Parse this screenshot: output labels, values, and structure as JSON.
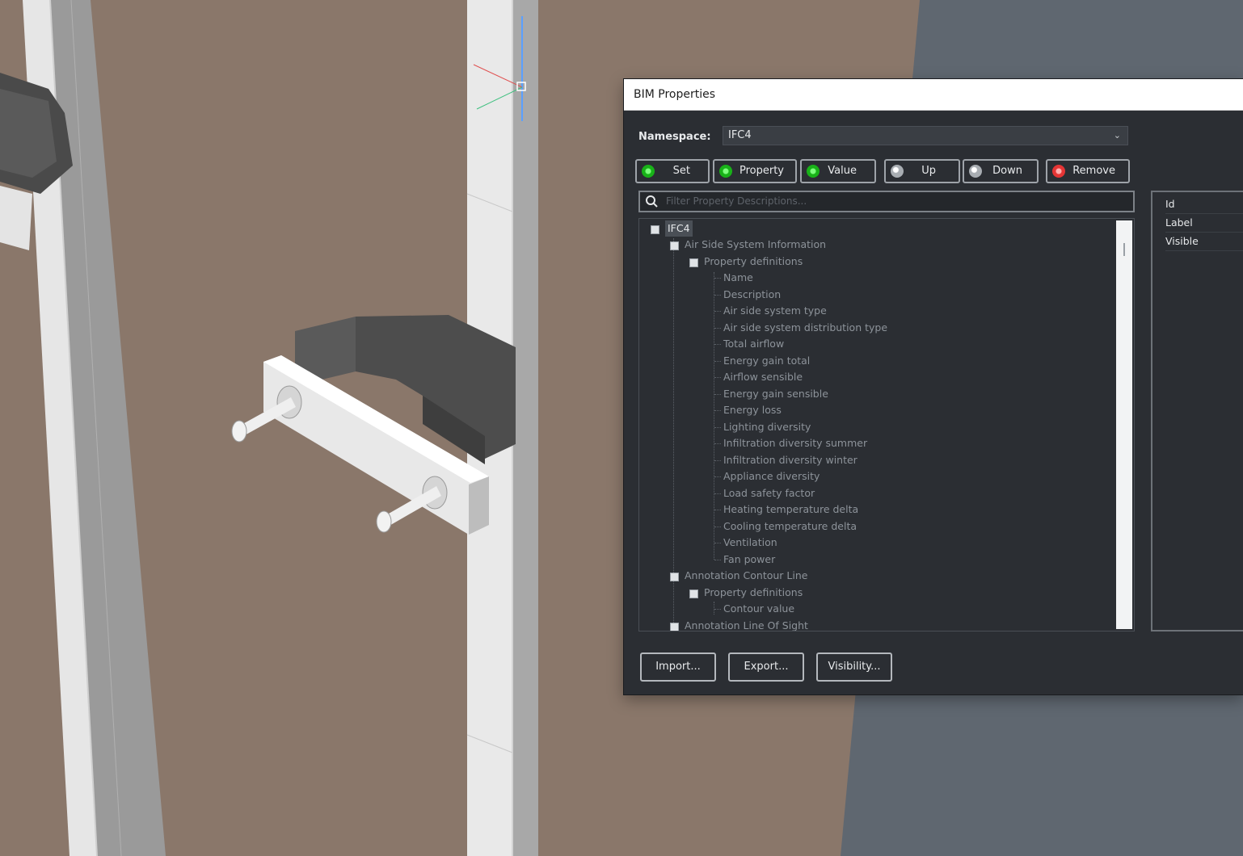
{
  "dialog": {
    "title": "BIM Properties",
    "namespace_label": "Namespace:",
    "namespace_value": "IFC4",
    "toolbar": [
      {
        "label": "Set",
        "icon": "add-icon"
      },
      {
        "label": "Property",
        "icon": "add-icon"
      },
      {
        "label": "Value",
        "icon": "add-icon"
      },
      {
        "label": "Up",
        "icon": "up-icon"
      },
      {
        "label": "Down",
        "icon": "down-icon"
      },
      {
        "label": "Remove",
        "icon": "remove-icon"
      }
    ],
    "search_placeholder": "Filter Property Descriptions...",
    "tree": {
      "root": "IFC4",
      "set1": "Air Side System Information",
      "set1_group": "Property definitions",
      "set1_props": [
        "Name",
        "Description",
        "Air side system type",
        "Air side system distribution type",
        "Total airflow",
        "Energy gain total",
        "Airflow sensible",
        "Energy gain sensible",
        "Energy loss",
        "Lighting diversity",
        "Infiltration diversity summer",
        "Infiltration diversity winter",
        "Appliance diversity",
        "Load safety factor",
        "Heating temperature delta",
        "Cooling temperature delta",
        "Ventilation",
        "Fan power"
      ],
      "set2": "Annotation Contour Line",
      "set2_group": "Property definitions",
      "set2_props": [
        "Contour value"
      ],
      "set3": "Annotation Line Of Sight"
    },
    "side_panel": [
      "Id",
      "Label",
      "Visible"
    ],
    "bottom_buttons": [
      "Import...",
      "Export...",
      "Visibility..."
    ]
  },
  "colors": {
    "wall": "#8a776a",
    "background_right": "#5f6770",
    "dialog_bg": "#2b2e33",
    "accent_green": "#18b218",
    "accent_red": "#e53535"
  }
}
